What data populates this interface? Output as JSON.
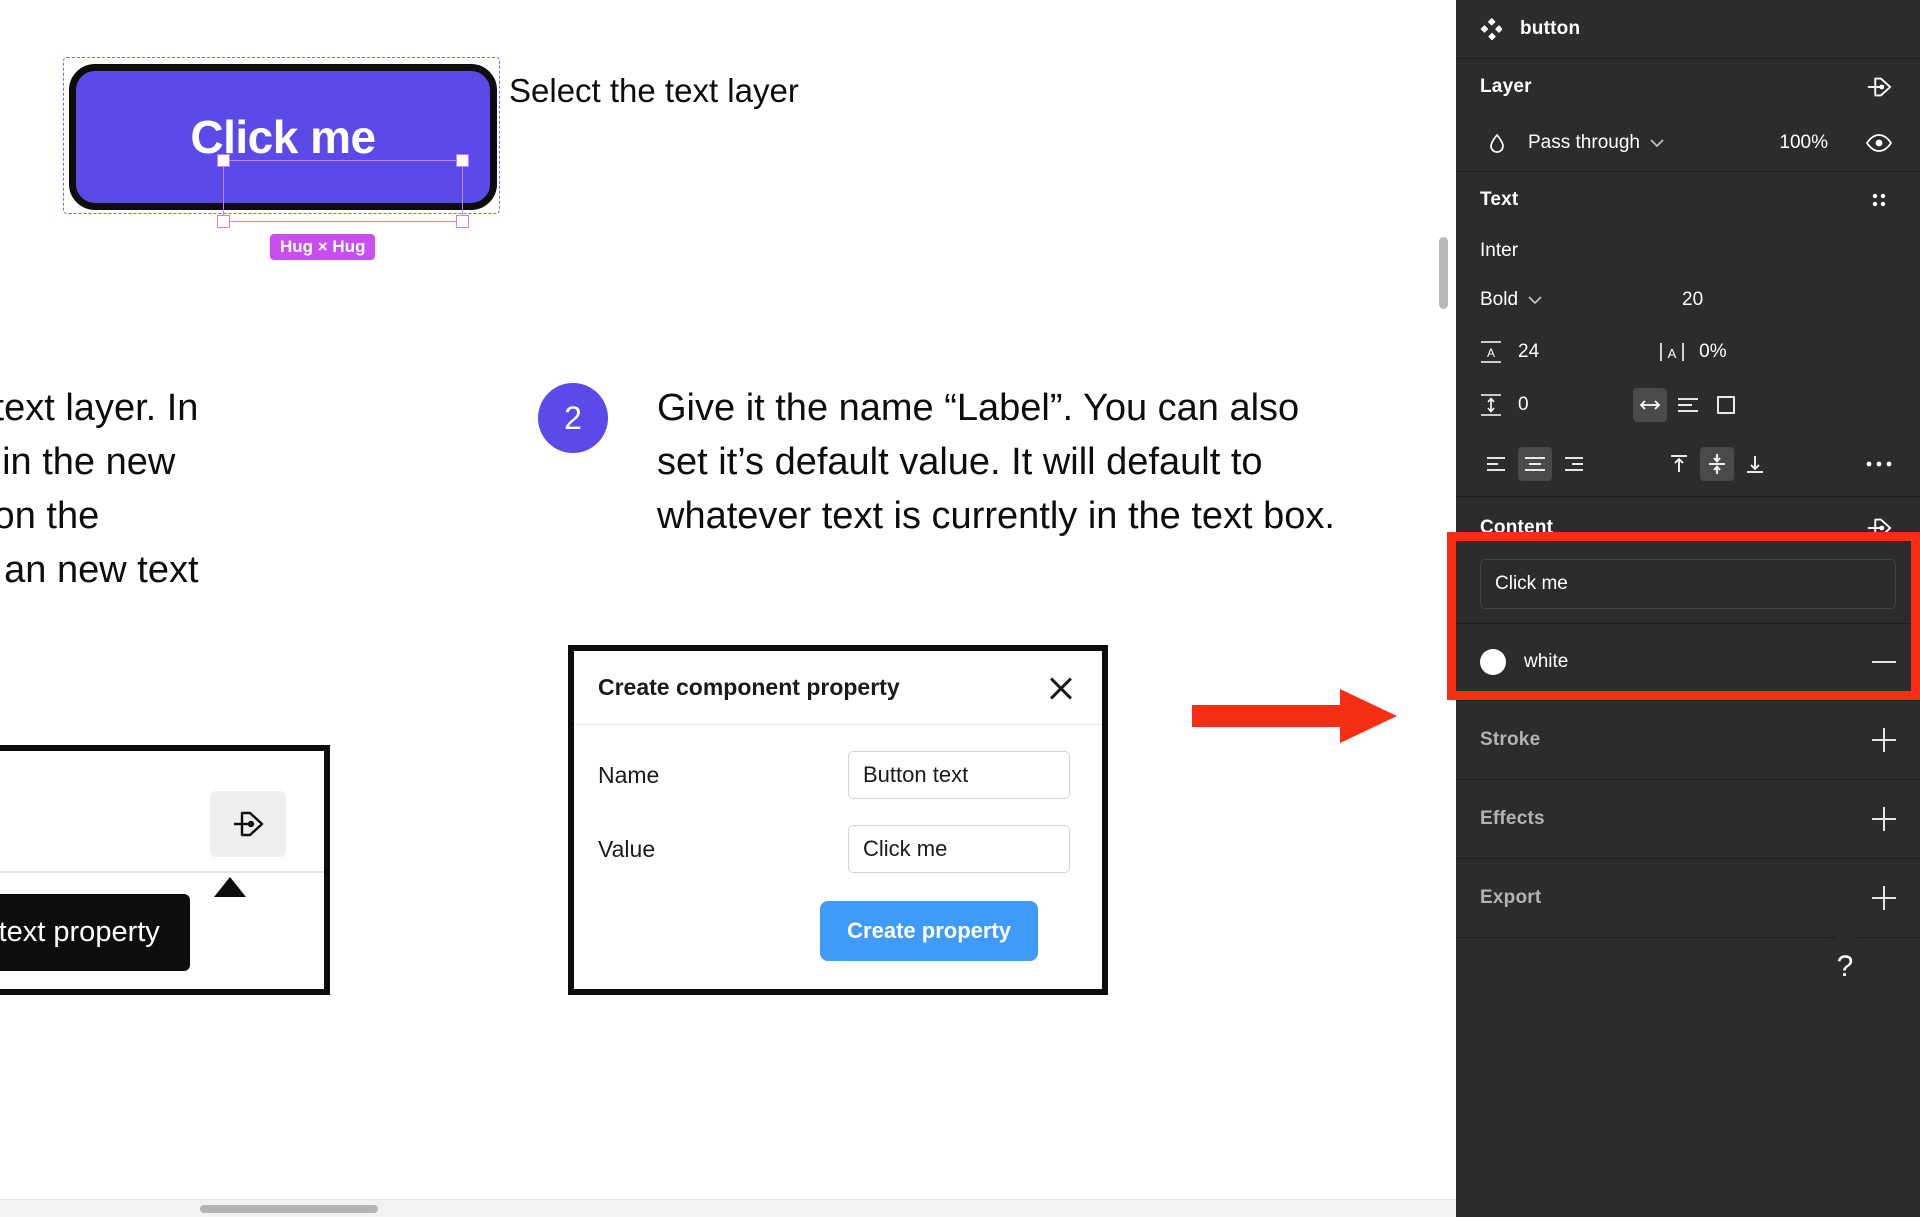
{
  "canvas": {
    "sample_button": {
      "label": "Click me",
      "size_badge": "Hug × Hug",
      "fill": "#5b4ae8",
      "selection_color": "#c77dff",
      "badge_color": "#c94ef0"
    },
    "caption_select_text_layer": "Select the text layer",
    "paragraph_left": "k me” text layer. In  panel, in the new , click on the  create an new text",
    "step2": {
      "number": "2",
      "text": "Give it the name “Label”. You can also set it’s default value. It will default to whatever text is currently in the text box.",
      "badge_color": "#5b4ae8"
    },
    "snippet_left": {
      "icon": "apply-text-property-icon",
      "tooltip": "Apply text property"
    },
    "dialog": {
      "title": "Create component property",
      "close_icon": "close-icon",
      "fields": [
        {
          "label": "Name",
          "value": "Button text"
        },
        {
          "label": "Value",
          "value": "Click me"
        }
      ],
      "primary_button": "Create property",
      "primary_color": "#3f9bf7"
    }
  },
  "annotation": {
    "highlight_color": "#f62f14",
    "arrow_color": "#f62f14",
    "target": "Content"
  },
  "panel": {
    "layer_name": "button",
    "layer_icon": "component-icon",
    "sections": {
      "layer": {
        "title": "Layer",
        "apply_icon": "apply-property-icon",
        "blend_icon": "blend-mode-icon",
        "blend_mode": "Pass through",
        "chevron": "chevron-down-icon",
        "opacity": "100%",
        "visibility_icon": "eye-icon"
      },
      "text": {
        "title": "Text",
        "options_icon": "text-options-icon",
        "font_family": "Inter",
        "font_style": "Bold",
        "style_chevron": "chevron-down-icon",
        "font_size": "20",
        "line_height_icon": "line-height-icon",
        "line_height": "24",
        "letter_spacing_icon": "letter-spacing-icon",
        "letter_spacing": "0%",
        "paragraph_spacing_icon": "paragraph-spacing-icon",
        "paragraph_spacing": "0",
        "resize_auto_width_icon": "auto-width-icon",
        "resize_auto_height_icon": "auto-height-icon",
        "resize_fixed_icon": "fixed-size-icon",
        "align_left_icon": "align-text-left-icon",
        "align_center_icon": "align-text-center-icon",
        "align_right_icon": "align-text-right-icon",
        "valign_top_icon": "align-top-icon",
        "valign_middle_icon": "align-middle-icon",
        "valign_bottom_icon": "align-bottom-icon",
        "more_icon": "more-options-icon"
      },
      "content": {
        "title": "Content",
        "apply_icon": "apply-property-icon",
        "value": "Click me"
      },
      "fill": {
        "swatch_color": "#ffffff",
        "name": "white",
        "remove_icon": "minus-icon"
      },
      "stroke": {
        "title": "Stroke",
        "add_icon": "plus-icon"
      },
      "effects": {
        "title": "Effects",
        "add_icon": "plus-icon"
      },
      "export": {
        "title": "Export",
        "add_icon": "plus-icon"
      }
    },
    "help": {
      "label": "?",
      "icon": "help-icon"
    }
  }
}
